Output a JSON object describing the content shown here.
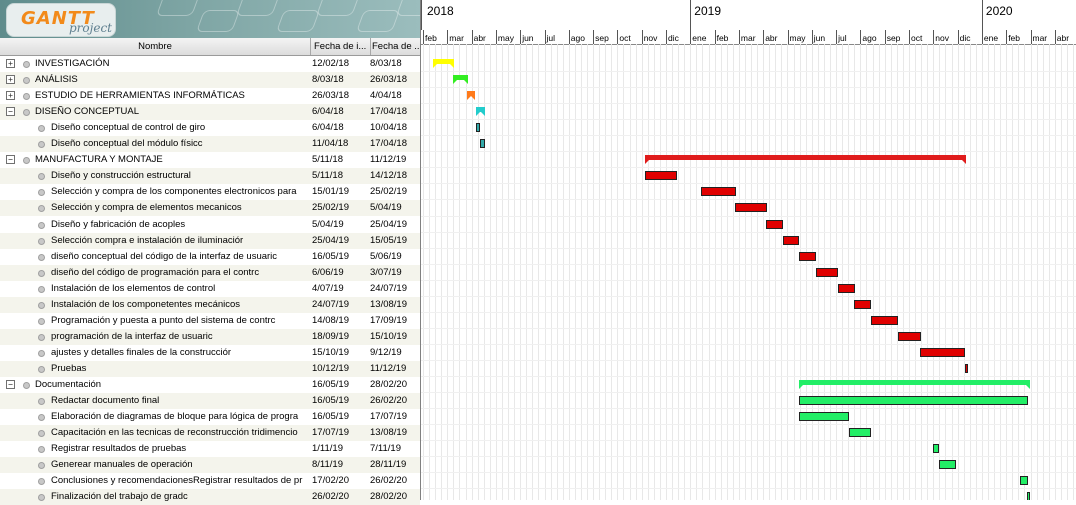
{
  "app": {
    "logo_word": "GANTT",
    "logo_sub": "project"
  },
  "columns": {
    "name": "Nombre",
    "start": "Fecha de i...",
    "end": "Fecha de ..."
  },
  "timeline": {
    "years": [
      "2018",
      "2019",
      "2020"
    ],
    "months": [
      "feb",
      "mar",
      "abr",
      "may",
      "jun",
      "jul",
      "ago",
      "sep",
      "oct",
      "nov",
      "dic",
      "ene",
      "feb",
      "mar",
      "abr",
      "may",
      "jun",
      "jul",
      "ago",
      "sep",
      "oct",
      "nov",
      "dic",
      "ene",
      "feb",
      "mar",
      "abr"
    ]
  },
  "colors": {
    "summary_yellow": "#ffff00",
    "summary_green": "#33ee22",
    "summary_orange": "#ff7a1a",
    "summary_cyan": "#22cccc",
    "task_cyan": "#33aaaa",
    "summary_red": "#e01c1c",
    "task_red": "#e00000",
    "summary_ltgreen": "#22ee66",
    "task_ltgreen": "#22ee66"
  },
  "tasks": [
    {
      "level": 0,
      "expander": "+",
      "name": "INVESTIGACIÓN",
      "start": "12/02/18",
      "end": "8/03/18"
    },
    {
      "level": 0,
      "expander": "+",
      "name": "ANÁLISIS",
      "start": "8/03/18",
      "end": "26/03/18"
    },
    {
      "level": 0,
      "expander": "+",
      "name": "ESTUDIO DE HERRAMIENTAS INFORMÁTICAS",
      "start": "26/03/18",
      "end": "4/04/18"
    },
    {
      "level": 0,
      "expander": "−",
      "name": "DISEÑO CONCEPTUAL",
      "start": "6/04/18",
      "end": "17/04/18"
    },
    {
      "level": 1,
      "expander": "",
      "name": "Diseño conceptual de control de giro",
      "start": "6/04/18",
      "end": "10/04/18"
    },
    {
      "level": 1,
      "expander": "",
      "name": "Diseño conceptual del módulo físicc",
      "start": "11/04/18",
      "end": "17/04/18"
    },
    {
      "level": 0,
      "expander": "−",
      "name": "MANUFACTURA Y MONTAJE",
      "start": "5/11/18",
      "end": "11/12/19"
    },
    {
      "level": 1,
      "expander": "",
      "name": "Diseño y construcción estructural",
      "start": "5/11/18",
      "end": "14/12/18"
    },
    {
      "level": 1,
      "expander": "",
      "name": "Selección y compra de los componentes electronicos para",
      "start": "15/01/19",
      "end": "25/02/19"
    },
    {
      "level": 1,
      "expander": "",
      "name": "Selección y compra de elementos mecanicos",
      "start": "25/02/19",
      "end": "5/04/19"
    },
    {
      "level": 1,
      "expander": "",
      "name": "Diseño y fabricación de acoples",
      "start": "5/04/19",
      "end": "25/04/19"
    },
    {
      "level": 1,
      "expander": "",
      "name": "Selección compra e instalación de iluminaciór",
      "start": "25/04/19",
      "end": "15/05/19"
    },
    {
      "level": 1,
      "expander": "",
      "name": "diseño conceptual del código de la interfaz de usuaric",
      "start": "16/05/19",
      "end": "5/06/19"
    },
    {
      "level": 1,
      "expander": "",
      "name": "diseño del código de programación para el contrc",
      "start": "6/06/19",
      "end": "3/07/19"
    },
    {
      "level": 1,
      "expander": "",
      "name": "Instalación de los elementos de control",
      "start": "4/07/19",
      "end": "24/07/19"
    },
    {
      "level": 1,
      "expander": "",
      "name": "Instalación de los componetentes mecánicos",
      "start": "24/07/19",
      "end": "13/08/19"
    },
    {
      "level": 1,
      "expander": "",
      "name": "Programación  y puesta a punto del sistema de contrc",
      "start": "14/08/19",
      "end": "17/09/19"
    },
    {
      "level": 1,
      "expander": "",
      "name": "programación de la interfaz de usuaric",
      "start": "18/09/19",
      "end": "15/10/19"
    },
    {
      "level": 1,
      "expander": "",
      "name": "ajustes y detalles finales de la construcciór",
      "start": "15/10/19",
      "end": "9/12/19"
    },
    {
      "level": 1,
      "expander": "",
      "name": "Pruebas",
      "start": "10/12/19",
      "end": "11/12/19"
    },
    {
      "level": 0,
      "expander": "−",
      "name": "Documentación",
      "start": "16/05/19",
      "end": "28/02/20"
    },
    {
      "level": 1,
      "expander": "",
      "name": "Redactar documento final",
      "start": "16/05/19",
      "end": "26/02/20"
    },
    {
      "level": 1,
      "expander": "",
      "name": "Elaboración de diagramas de bloque para lógica de progra",
      "start": "16/05/19",
      "end": "17/07/19"
    },
    {
      "level": 1,
      "expander": "",
      "name": "Capacitación en las tecnicas de reconstrucción tridimencio",
      "start": "17/07/19",
      "end": "13/08/19"
    },
    {
      "level": 1,
      "expander": "",
      "name": "Registrar resultados de pruebas",
      "start": "1/11/19",
      "end": "7/11/19"
    },
    {
      "level": 1,
      "expander": "",
      "name": "Generear manuales de operación",
      "start": "8/11/19",
      "end": "28/11/19"
    },
    {
      "level": 1,
      "expander": "",
      "name": "Conclusiones y recomendacionesRegistrar resultados de pr",
      "start": "17/02/20",
      "end": "26/02/20"
    },
    {
      "level": 1,
      "expander": "",
      "name": "Finalización del trabajo de gradc",
      "start": "26/02/20",
      "end": "28/02/20"
    }
  ]
}
